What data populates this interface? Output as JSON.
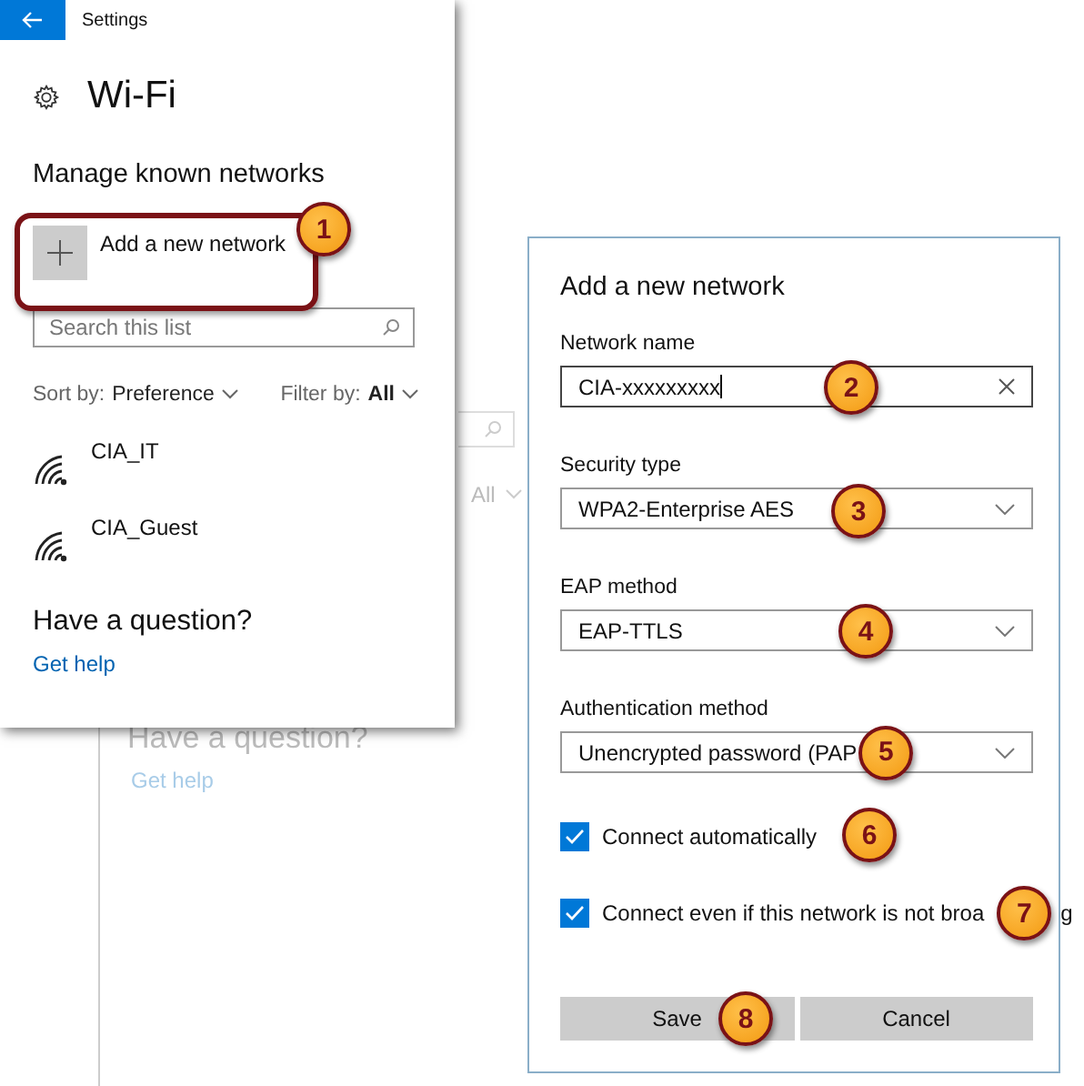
{
  "window": {
    "title": "Settings"
  },
  "page": {
    "title": "Wi-Fi",
    "section": "Manage known networks",
    "add_button": "Add a new network",
    "search": {
      "placeholder": "Search this list"
    },
    "sort": {
      "label": "Sort by:",
      "value": "Preference"
    },
    "filter": {
      "label": "Filter by:",
      "value": "All"
    },
    "networks": [
      {
        "name": "CIA_IT"
      },
      {
        "name": "CIA_Guest"
      }
    ],
    "help": {
      "heading": "Have a question?",
      "link": "Get help"
    }
  },
  "background_window": {
    "filter_value": "All",
    "help_heading": "Have a question?",
    "help_link": "Get help"
  },
  "dialog": {
    "title": "Add a new network",
    "fields": [
      {
        "label": "Network name",
        "kind": "text",
        "value": "CIA-xxxxxxxxx"
      },
      {
        "label": "Security type",
        "kind": "dropdown",
        "value": "WPA2-Enterprise AES"
      },
      {
        "label": "EAP method",
        "kind": "dropdown",
        "value": "EAP-TTLS"
      },
      {
        "label": "Authentication method",
        "kind": "dropdown",
        "value": "Unencrypted password (PAP"
      }
    ],
    "checkboxes": [
      {
        "label": "Connect automatically",
        "checked": true
      },
      {
        "label": "Connect even if this network is not broa",
        "label_end": "g",
        "checked": true
      }
    ],
    "buttons": [
      {
        "label": "Save"
      },
      {
        "label": "Cancel"
      }
    ]
  },
  "callouts": [
    "1",
    "2",
    "3",
    "4",
    "5",
    "6",
    "7",
    "8"
  ]
}
